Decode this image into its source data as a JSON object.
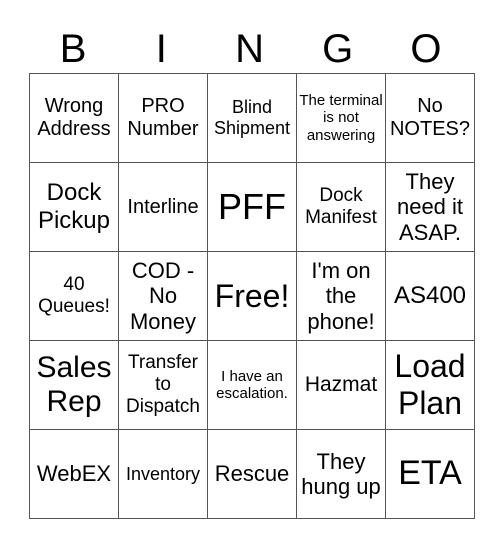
{
  "header": {
    "letters": [
      "B",
      "I",
      "N",
      "G",
      "O"
    ]
  },
  "grid": [
    [
      {
        "text": "Wrong Address",
        "size": 20
      },
      {
        "text": "PRO Number",
        "size": 20
      },
      {
        "text": "Blind Shipment",
        "size": 18
      },
      {
        "text": "The terminal is not answering",
        "size": 15
      },
      {
        "text": "No NOTES?",
        "size": 20
      }
    ],
    [
      {
        "text": "Dock Pickup",
        "size": 24
      },
      {
        "text": "Interline",
        "size": 20
      },
      {
        "text": "PFF",
        "size": 36
      },
      {
        "text": "Dock Manifest",
        "size": 19
      },
      {
        "text": "They need it ASAP.",
        "size": 22
      }
    ],
    [
      {
        "text": "40 Queues!",
        "size": 19
      },
      {
        "text": "COD - No Money",
        "size": 22
      },
      {
        "text": "Free!",
        "size": 32
      },
      {
        "text": "I'm on the phone!",
        "size": 22
      },
      {
        "text": "AS400",
        "size": 24
      }
    ],
    [
      {
        "text": "Sales Rep",
        "size": 30
      },
      {
        "text": "Transfer to Dispatch",
        "size": 19
      },
      {
        "text": "I have an escalation.",
        "size": 15
      },
      {
        "text": "Hazmat",
        "size": 21
      },
      {
        "text": "Load Plan",
        "size": 32
      }
    ],
    [
      {
        "text": "WebEX",
        "size": 22
      },
      {
        "text": "Inventory",
        "size": 18
      },
      {
        "text": "Rescue",
        "size": 22
      },
      {
        "text": "They hung up",
        "size": 22
      },
      {
        "text": "ETA",
        "size": 34
      }
    ]
  ]
}
